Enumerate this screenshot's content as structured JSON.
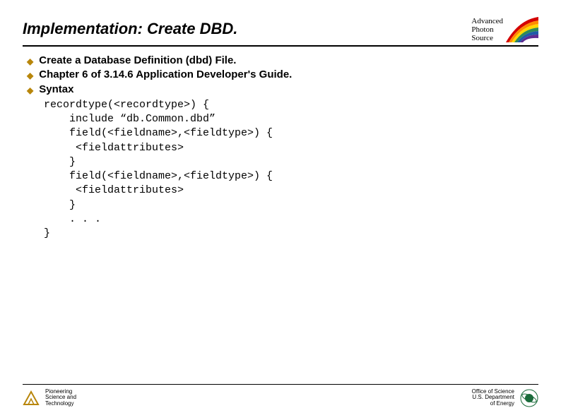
{
  "header": {
    "title": "Implementation: Create DBD.",
    "aps": {
      "line1": "Advanced",
      "line2": "Photon",
      "line3": "Source"
    }
  },
  "bullets": [
    "Create a Database Definition (dbd) File.",
    "Chapter 6 of 3.14.6 Application Developer's Guide.",
    "Syntax"
  ],
  "code": "recordtype(<recordtype>) {\n    include “db.Common.dbd”\n    field(<fieldname>,<fieldtype>) {\n     <fieldattributes>\n    }\n    field(<fieldname>,<fieldtype>) {\n     <fieldattributes>\n    }\n    . . .\n}",
  "footer": {
    "left": {
      "line1": "Pioneering",
      "line2": "Science and",
      "line3": "Technology"
    },
    "right": {
      "line1": "Office of Science",
      "line2": "U.S. Department",
      "line3": "of Energy"
    }
  }
}
